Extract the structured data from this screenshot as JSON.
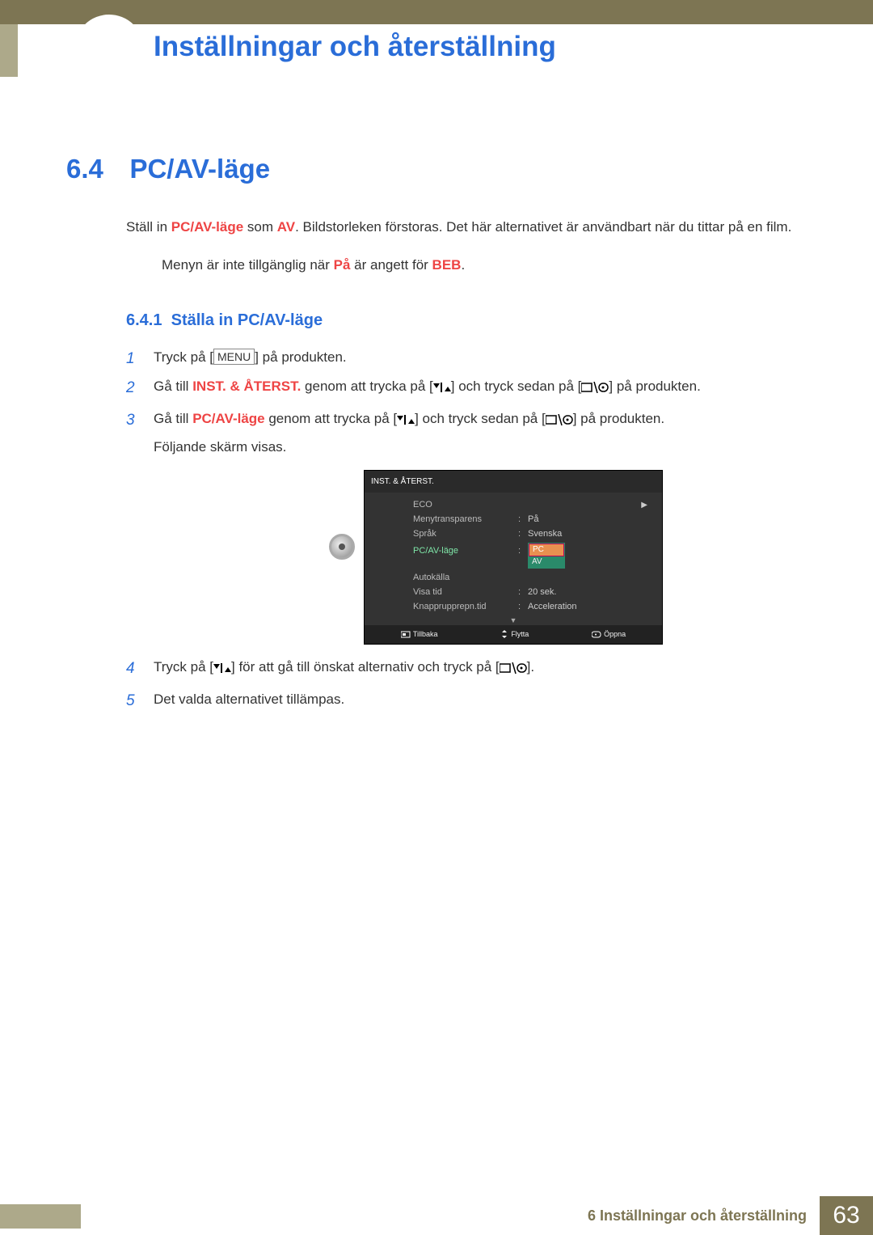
{
  "header": {
    "chapter_title": "Inställningar och återställning"
  },
  "section": {
    "number": "6.4",
    "title": "PC/AV-läge"
  },
  "intro": {
    "pre": "Ställ in ",
    "mode": "PC/AV-läge",
    "mid": " som ",
    "av": "AV",
    "post": ". Bildstorleken förstoras. Det här alternativet är användbart när du tittar på en film."
  },
  "note": {
    "pre": "Menyn är inte tillgänglig när ",
    "on": "På",
    "mid": " är angett för ",
    "beb": "BEB",
    "post": "."
  },
  "subsection": {
    "number": "6.4.1",
    "title": "Ställa in PC/AV-läge"
  },
  "steps": {
    "s1": {
      "num": "1",
      "pre": "Tryck på [",
      "button": "MENU",
      "post": "] på produkten."
    },
    "s2": {
      "num": "2",
      "pre": "Gå till ",
      "target": "INST. & ÅTERST.",
      "mid": " genom att trycka på [",
      "mid2": "] och tryck sedan på [",
      "post": "] på produkten."
    },
    "s3": {
      "num": "3",
      "pre": "Gå till ",
      "target": "PC/AV-läge",
      "mid": " genom att trycka på [",
      "mid2": "] och tryck sedan på [",
      "post": "] på produkten.",
      "sub": "Följande skärm visas."
    },
    "s4": {
      "num": "4",
      "pre": "Tryck på [",
      "mid": "] för att gå till önskat alternativ och tryck på [",
      "post": "]."
    },
    "s5": {
      "num": "5",
      "text": "Det valda alternativet tillämpas."
    }
  },
  "osd": {
    "title": "INST. & ÅTERST.",
    "rows": {
      "eco": "ECO",
      "menytransparens": {
        "label": "Menytransparens",
        "value": "På"
      },
      "sprak": {
        "label": "Språk",
        "value": "Svenska"
      },
      "pcav": {
        "label": "PC/AV-läge",
        "opts": [
          "PC",
          "AV"
        ]
      },
      "autokalla": {
        "label": "Autokälla"
      },
      "visatid": {
        "label": "Visa tid",
        "value": "20 sek."
      },
      "knapp": {
        "label": "Knapprupprepn.tid",
        "value": "Acceleration"
      }
    },
    "footer": {
      "back": "Tillbaka",
      "move": "Flytta",
      "open": "Öppna"
    }
  },
  "footer": {
    "chapter_label": "6 Inställningar och återställning",
    "page": "63"
  }
}
